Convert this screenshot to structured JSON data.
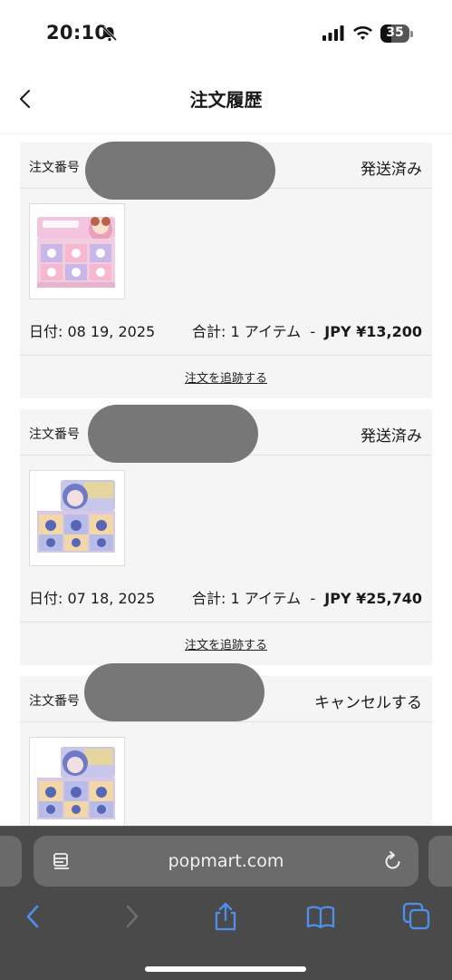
{
  "status_bar": {
    "time": "20:10",
    "battery": "35"
  },
  "header": {
    "title": "注文履歴"
  },
  "orders": [
    {
      "number_label": "注文番号",
      "status": "発送済み",
      "date": "日付: 08 19, 2025",
      "total_prefix": "合計: 1 アイテム  -  ",
      "total_amount": "JPY ¥13,200",
      "track_label": "注文を追跡する"
    },
    {
      "number_label": "注文番号",
      "status": "発送済み",
      "date": "日付: 07 18, 2025",
      "total_prefix": "合計: 1 アイテム  -  ",
      "total_amount": "JPY ¥25,740",
      "track_label": "注文を追跡する"
    },
    {
      "number_label": "注文番号",
      "status": "キャンセルする"
    }
  ],
  "browser": {
    "url": "popmart.com"
  },
  "colors": {
    "card_bg": "#f5f5f5",
    "browser_bar": "#4a4a4a",
    "toolbar_icon": "#4d8ff0"
  }
}
